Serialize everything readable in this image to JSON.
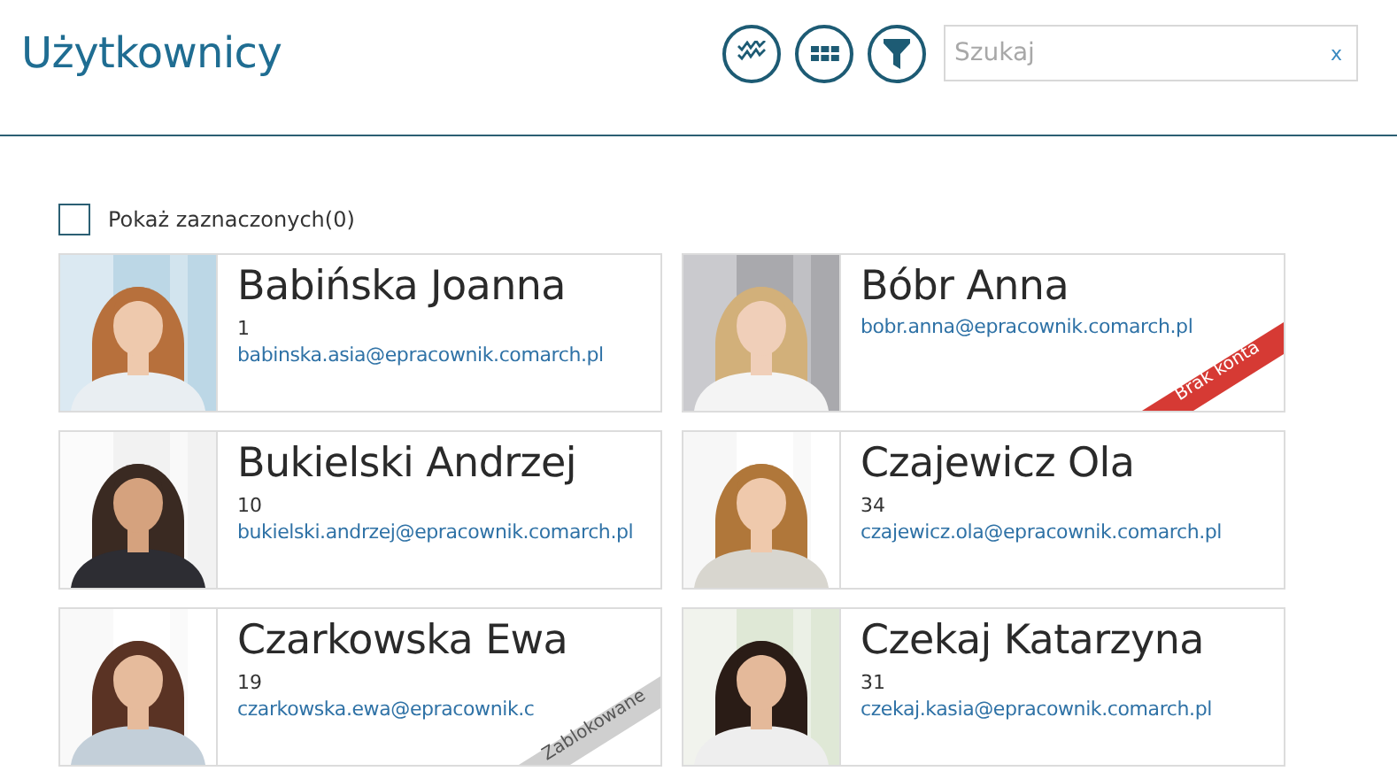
{
  "header": {
    "title": "Użytkownicy",
    "search": {
      "placeholder": "Szukaj",
      "clear": "x"
    }
  },
  "show_selected": {
    "label": "Pokaż zaznaczonych(0)",
    "checked": false
  },
  "users": [
    {
      "name": "Babińska Joanna",
      "number": "1",
      "email": "babinska.asia@epracownik.comarch.pl"
    },
    {
      "name": "Bóbr Anna",
      "email": "bobr.anna@epracownik.comarch.pl",
      "ribbon": {
        "kind": "no-account",
        "text": "Brak konta"
      }
    },
    {
      "name": "Bukielski Andrzej",
      "number": "10",
      "email": "bukielski.andrzej@epracownik.comarch.pl"
    },
    {
      "name": "Czajewicz Ola",
      "number": "34",
      "email": "czajewicz.ola@epracownik.comarch.pl"
    },
    {
      "name": "Czarkowska Ewa",
      "number": "19",
      "email": "czarkowska.ewa@epracownik.c",
      "ribbon": {
        "kind": "blocked",
        "text": "Zablokowane"
      }
    },
    {
      "name": "Czekaj Katarzyna",
      "number": "31",
      "email": "czekaj.kasia@epracownik.comarch.pl"
    }
  ]
}
